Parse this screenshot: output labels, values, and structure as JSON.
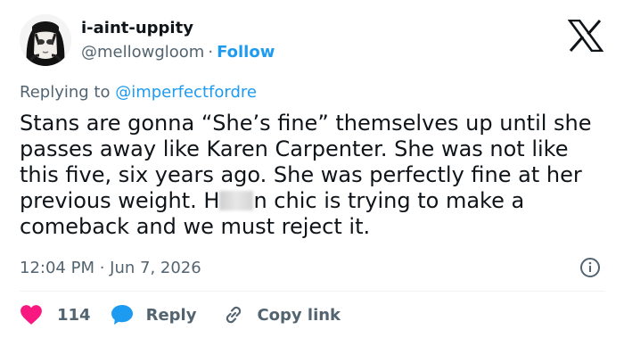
{
  "author": {
    "display_name": "i-aint-uppity",
    "handle": "@mellowgloom",
    "separator": "·",
    "follow_label": "Follow"
  },
  "reply_context": {
    "prefix": "Replying to ",
    "mention": "@imperfectfordre"
  },
  "tweet": {
    "text_before_blur": "Stans are gonna “She’s fine” themselves up until she passes away like Karen Carpenter. She was not like this five, six years ago. She was perfectly fine at her previous weight. H",
    "text_after_blur": "n chic is trying to make a comeback and we must reject it.",
    "timestamp": "12:04 PM · Jun 7, 2026"
  },
  "actions": {
    "like_count": "114",
    "reply_label": "Reply",
    "copy_link_label": "Copy link"
  },
  "icons": {
    "brand": "x-logo-icon",
    "info": "info-icon",
    "like": "heart-icon",
    "reply": "reply-bubble-icon",
    "copy": "link-icon"
  },
  "colors": {
    "accent": "#1d9bf0",
    "like": "#f91880",
    "muted": "#536471",
    "text": "#0f1419"
  }
}
